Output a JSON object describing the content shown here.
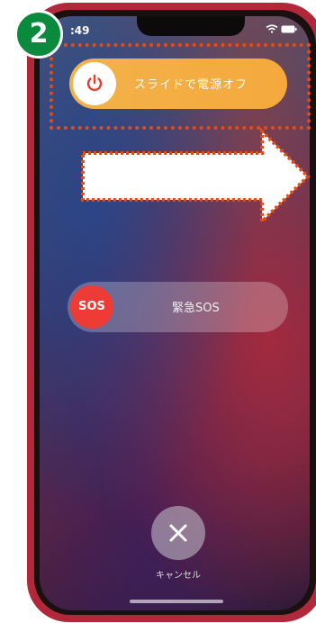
{
  "step_badge": "2",
  "status_bar": {
    "time": ":49"
  },
  "power_slider": {
    "label": "スライドで電源オフ"
  },
  "sos_slider": {
    "knob_label": "SOS",
    "label": "緊急SOS"
  },
  "cancel": {
    "label": "キャンセル"
  },
  "colors": {
    "accent_orange": "#f5a93c",
    "highlight": "#e84a12",
    "sos_red": "#ef3b36",
    "badge_green": "#0b8a3d"
  }
}
